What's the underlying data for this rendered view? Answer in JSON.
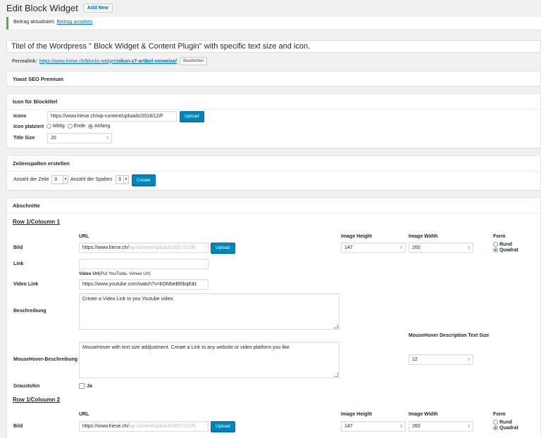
{
  "header": {
    "title": "Edit Block Widget",
    "add_new": "Add New"
  },
  "notice": {
    "text": "Beitrag aktualisiert.",
    "link": "Beitrag ansehen"
  },
  "post": {
    "title": "Titel of the Wordpress \" Block Widget & Content Plugin\" with specific text size and icon.",
    "permalink_label": "Permalink:",
    "permalink_base": "https://www.lriese.ch/blocks-widget/",
    "permalink_slug": "nikon-z7-artikel-verweise/",
    "edit_label": "Bearbeiten"
  },
  "yoast": {
    "title": "Yoast SEO Premium"
  },
  "icon_box": {
    "title": "Icon für Blocktitel",
    "icons_label": "Icons",
    "icons_value": "https://www.lriese.ch/wp-content/uploads/2018/12/F",
    "upload_label": "Upload",
    "position_label": "Icon platziert",
    "options": [
      "Mittig",
      "Ende",
      "Anfang"
    ],
    "selected": "Anfang",
    "title_size_label": "Title Size",
    "title_size_value": "20"
  },
  "rows_box": {
    "title": "Zeilenspalten erstellen",
    "rows_label": "Anzahl der Zeile",
    "rows_value": "3",
    "cols_label": "Anzahl der Spalten",
    "cols_value": "3",
    "create_label": "Create"
  },
  "sections": {
    "title": "Abschnitte",
    "col_url": "URL",
    "col_height": "Image Height",
    "col_width": "Image Width",
    "col_form": "Form",
    "form_options": [
      "Rund",
      "Quadrat"
    ],
    "row1": {
      "heading": "Row 1/Coloumn 1",
      "bild_label": "Bild",
      "url_value": "https://www.lriese.ch/",
      "url_faded": "wp-content/uploads/2017/12/N",
      "upload_label": "Upload",
      "height_value": "147",
      "width_value": "260",
      "form_selected": "Quadrat",
      "link_label": "Link",
      "link_value": "",
      "video_heading": "Video Url",
      "video_hint": "(Put YouTube, Vimeo Url)",
      "video_label": "Video Link",
      "video_value": "https://www.youtube.com/watch?v=bOMbeBl0bqE&t",
      "desc_label": "Beschreibung",
      "desc_value": "Create a Video Link to you Youtube video.",
      "mh_size_label": "MouseHover Description Text Size",
      "mh_label": "MouseHover-Beschreibung",
      "mh_value": "MouseHover with text size addjustment. Create a Link to any website or video platform you like.",
      "mh_size_value": "12",
      "gray_label": "Graustufen",
      "gray_option": "Ja"
    },
    "row2": {
      "heading": "Row 1/Coloumn 2",
      "bild_label": "Bild",
      "url_value": "https://www.lriese.ch/",
      "url_faded": "wp-content/uploads/2017/12/N",
      "upload_label": "Upload",
      "height_value": "147",
      "width_value": "260",
      "form_selected": "Quadrat"
    }
  }
}
